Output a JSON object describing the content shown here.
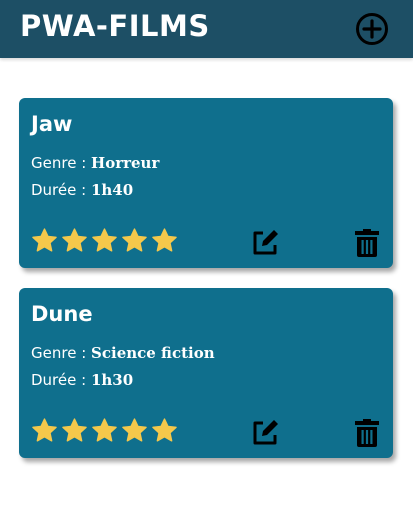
{
  "header": {
    "title": "PWA-FILMS",
    "add_icon": "add-circle-icon"
  },
  "colors": {
    "header_bg": "#1d4f65",
    "card_bg": "#0f6f8d",
    "star": "#f5c84b"
  },
  "films": [
    {
      "title": "Jaw",
      "genre_label": "Genre :",
      "genre": "Horreur",
      "duree_label": "Durée :",
      "duree": "1h40",
      "rating": 5,
      "max_rating": 5
    },
    {
      "title": "Dune",
      "genre_label": "Genre :",
      "genre": "Science fiction",
      "duree_label": "Durée :",
      "duree": "1h30",
      "rating": 5,
      "max_rating": 5
    }
  ]
}
